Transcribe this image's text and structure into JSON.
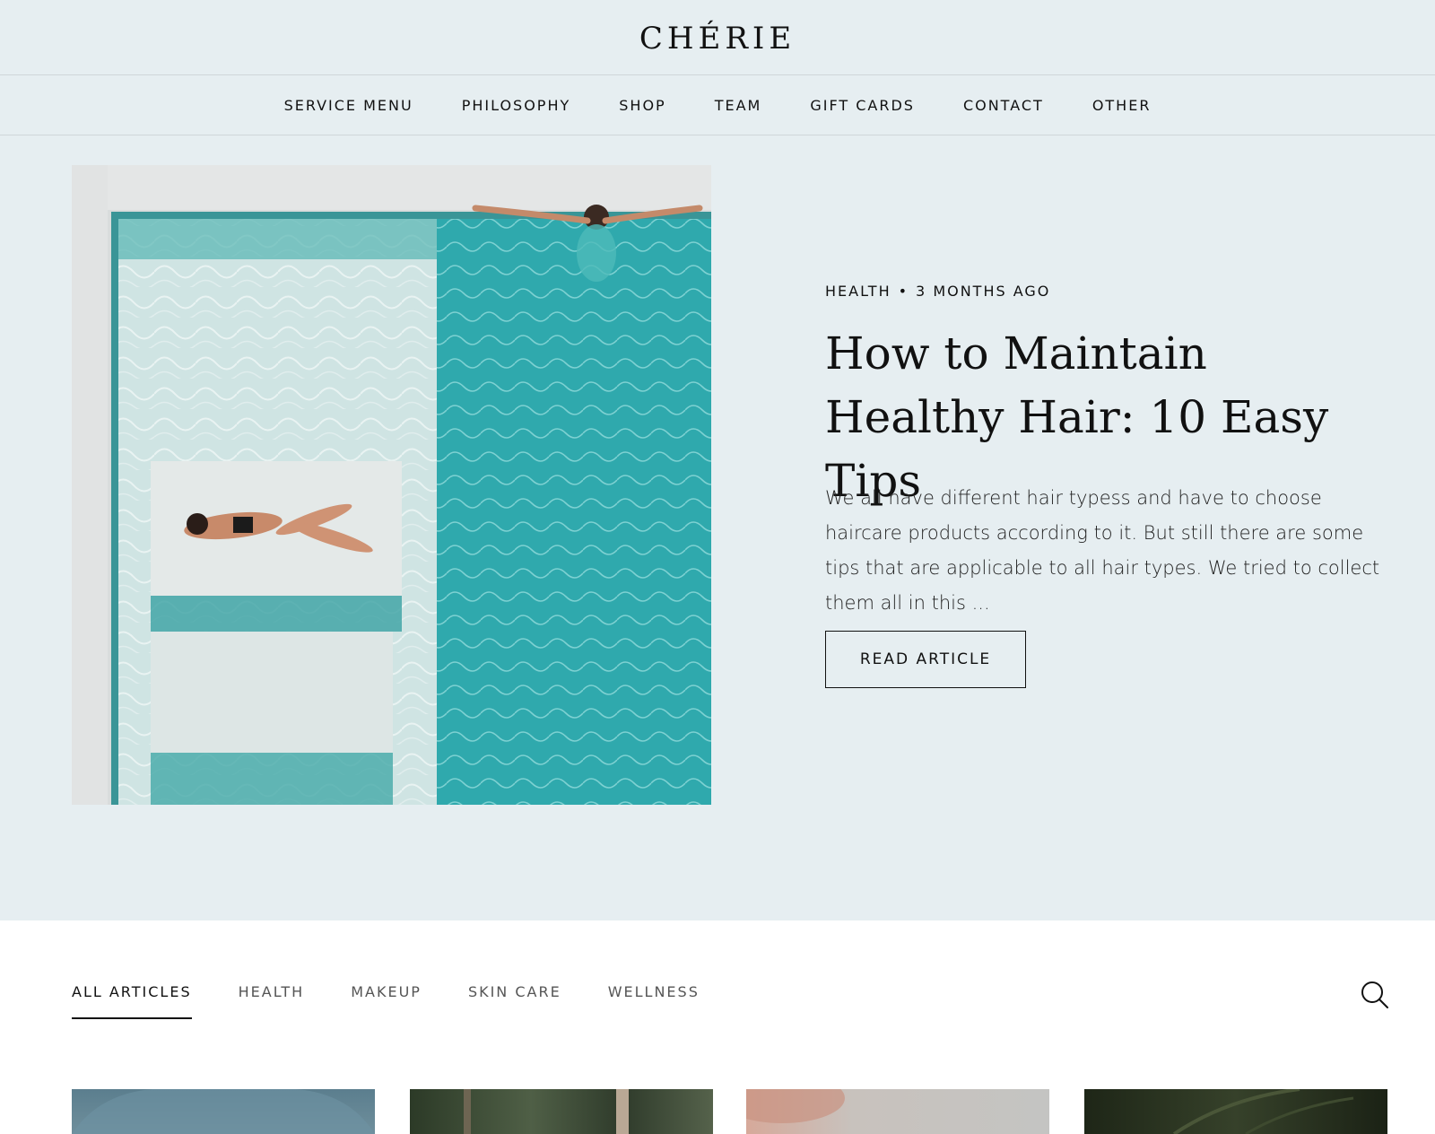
{
  "brand": {
    "logo": "CHÉRIE"
  },
  "nav": {
    "items": [
      {
        "label": "SERVICE MENU"
      },
      {
        "label": "PHILOSOPHY"
      },
      {
        "label": "SHOP"
      },
      {
        "label": "TEAM"
      },
      {
        "label": "GIFT CARDS"
      },
      {
        "label": "CONTACT"
      },
      {
        "label": "OTHER"
      }
    ]
  },
  "featured": {
    "category": "HEALTH",
    "separator": "•",
    "time_ago": "3 MONTHS AGO",
    "title": "How to Maintain Healthy Hair: 10 Easy Tips",
    "excerpt": "We all have different hair typess and have to choose haircare products according to it. But still there are some tips that are applicable to all hair types. We tried to collect them all in this ...",
    "button_label": "READ ARTICLE",
    "image_icon": "pool-aerial-photo"
  },
  "filters": {
    "tabs": [
      {
        "label": "ALL ARTICLES",
        "active": true
      },
      {
        "label": "HEALTH",
        "active": false
      },
      {
        "label": "MAKEUP",
        "active": false
      },
      {
        "label": "SKIN CARE",
        "active": false
      },
      {
        "label": "WELLNESS",
        "active": false
      }
    ],
    "search_icon": "search-icon"
  },
  "colors": {
    "background_tint": "#e6eef1",
    "text": "#111111",
    "pool_water": "#2fa9ad"
  }
}
